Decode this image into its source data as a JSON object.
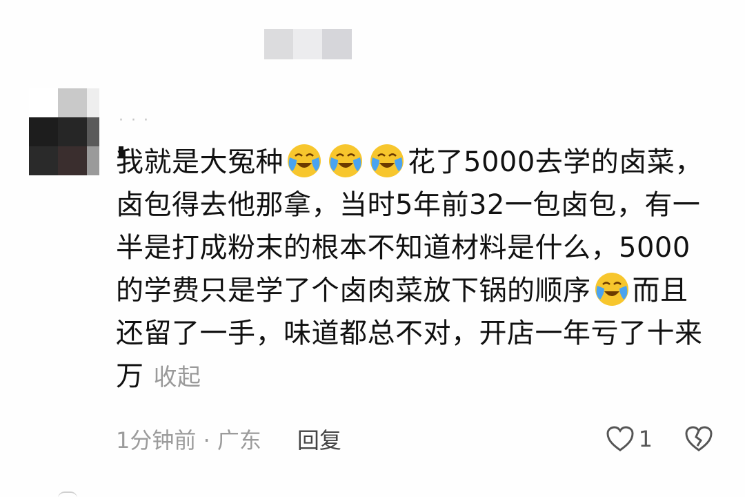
{
  "comment": {
    "lines": [
      [
        "我就是大冤种",
        "花了5000去学的卤菜，"
      ],
      "卤包得去他那拿，当时5年前32一包卤包，有一",
      "半是打成粉末的根本不知道材料是什么，5000",
      [
        "的学费只是学了个卤肉菜放下锅的顺序",
        "而且"
      ],
      "还留了一手，味道都总不对，开店一年亏了十来",
      "万"
    ],
    "collapse_label": "收起",
    "emoji": "crying-laughing-emoji"
  },
  "meta": {
    "time_location": "1分钟前 · 广东",
    "reply_label": "回复",
    "like_count": "1"
  },
  "colors": {
    "text": "#111111",
    "muted": "#9b9b9b",
    "emoji_face": "#f7c62d",
    "emoji_tears": "#4aa3f0"
  },
  "icons": {
    "like": "heart-outline-icon",
    "dislike": "broken-heart-icon"
  }
}
